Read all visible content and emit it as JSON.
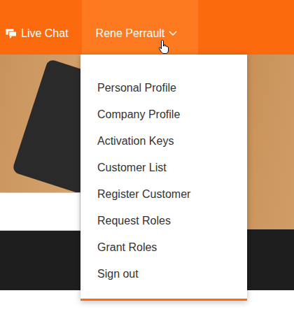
{
  "header": {
    "live_chat": {
      "label": "Live Chat"
    }
  },
  "user_menu": {
    "label": "Rene Perrault",
    "expanded": true,
    "items": [
      "Personal Profile",
      "Company Profile",
      "Activation Keys",
      "Customer List",
      "Register Customer",
      "Request Roles",
      "Grant Roles",
      "Sign out"
    ]
  }
}
